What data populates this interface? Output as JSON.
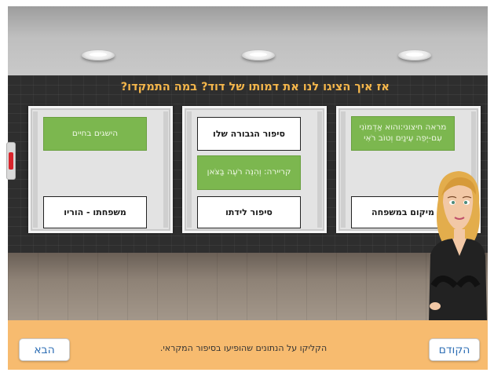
{
  "question": "אז איך הציגו לנו את דמותו של דוד? במה התמקדו?",
  "panels": [
    {
      "top_card": "מראה חיצוני:והוא אַדְמוֹנִי עִם-יְפֵה עֵינַיִם וְטוֹב רֹאִי",
      "bottom_card": "מיקום במשפחה"
    },
    {
      "top_card": "סיפור הגבורה שלו",
      "middle_card": "קריירה: וְהִנֵּה רֹעֶה בַּצֹּאן",
      "bottom_card": "סיפור לידתו"
    },
    {
      "top_card": "הישגים בחיים",
      "bottom_card": "משפחתו - הוריו"
    }
  ],
  "footer": {
    "instruction": "הקליקו על הנתונים שהופיעו בסיפור המקראי.",
    "prev_label": "הקודם",
    "next_label": "הבא"
  },
  "colors": {
    "question": "#f4b64b",
    "card_green": "#7cb74f",
    "footer_bg": "#f7bb6f",
    "nav_text": "#2f6fb5"
  }
}
